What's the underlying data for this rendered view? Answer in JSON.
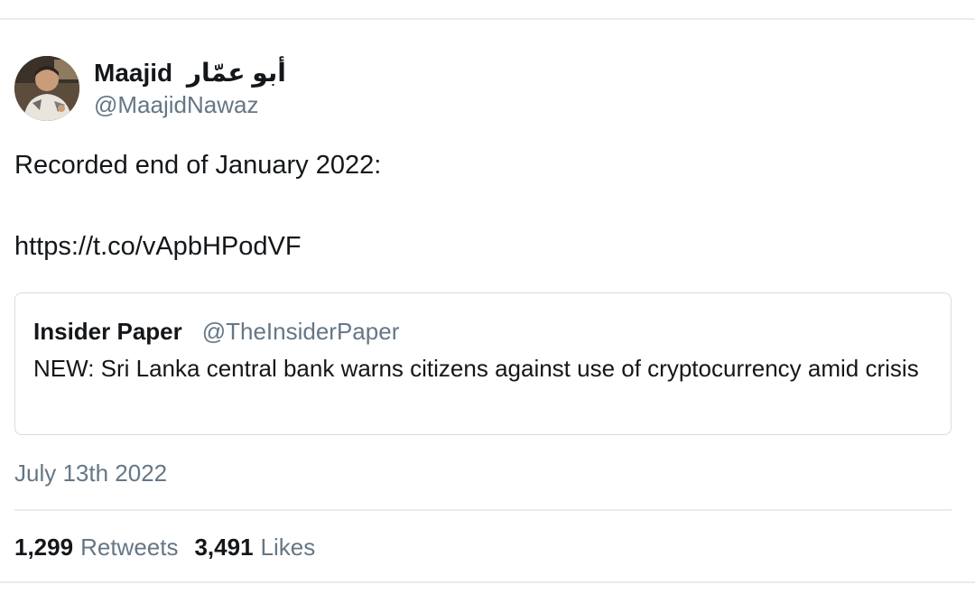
{
  "author": {
    "name_latin": "Maajid",
    "name_arabic": "أبو عمّار",
    "handle": "@MaajidNawaz"
  },
  "tweet": {
    "line1": "Recorded end of January 2022:",
    "link": "https://t.co/vApbHPodVF",
    "date": "July 13th 2022"
  },
  "quote": {
    "name": "Insider Paper",
    "handle": "@TheInsiderPaper",
    "text": "NEW: Sri Lanka central bank warns citizens against use of cryptocurrency amid crisis"
  },
  "stats": {
    "retweets_count": "1,299",
    "retweets_label": "Retweets",
    "likes_count": "3,491",
    "likes_label": "Likes"
  }
}
